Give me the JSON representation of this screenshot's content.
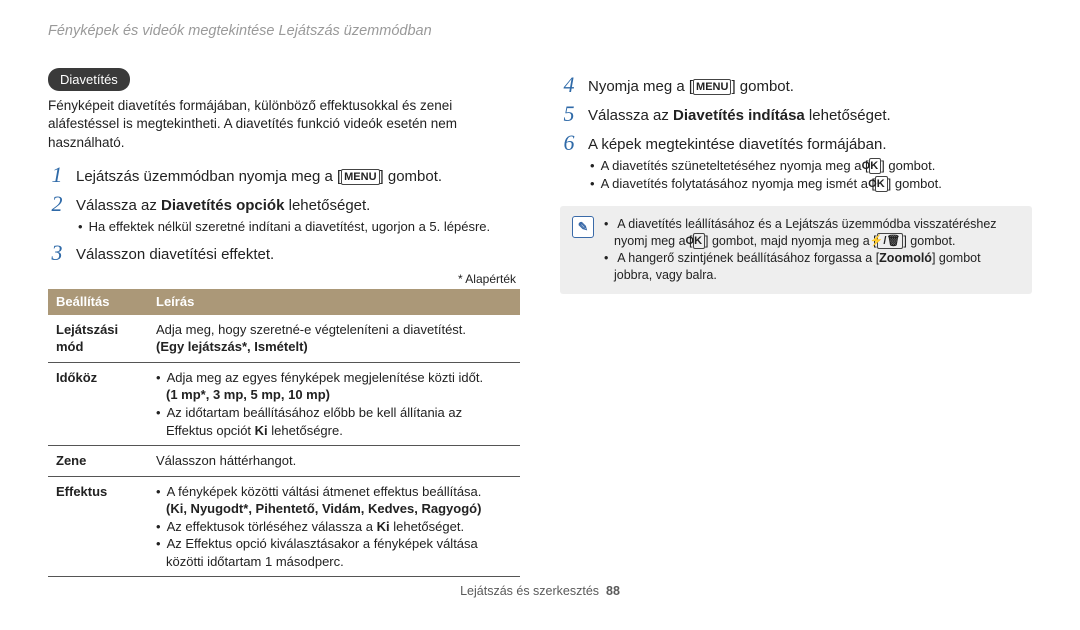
{
  "header": "Fényképek és videók megtekintése Lejátszás üzemmódban",
  "left": {
    "chip": "Diavetítés",
    "intro": "Fényképeit diavetítés formájában, különböző effektusokkal és zenei aláfestéssel is megtekintheti. A diavetítés funkció videók esetén nem használható.",
    "steps": {
      "s1_a": "Lejátszás üzemmódban nyomja meg a [",
      "s1_btn": "MENU",
      "s1_b": "] gombot.",
      "s2_a": "Válassza az ",
      "s2_bold": "Diavetítés opciók",
      "s2_b": " lehetőséget.",
      "s2_sub": "Ha effektek nélkül szeretné indítani a diavetítést, ugorjon a 5. lépésre.",
      "s3": "Válasszon diavetítési effektet."
    },
    "default_note": "* Alapérték",
    "table": {
      "h1": "Beállítás",
      "h2": "Leírás",
      "rows": [
        {
          "k": "Lejátszási mód",
          "lines": [
            "Adja meg, hogy szeretné-e végteleníteni a diavetítést."
          ],
          "opts": "(Egy lejátszás*, Ismételt)"
        },
        {
          "k": "Időköz",
          "bullets": [
            "Adja meg az egyes fényképek megjelenítése közti időt."
          ],
          "opts": "(1 mp*, 3 mp, 5 mp, 10 mp)",
          "bullets2": [
            "Az időtartam beállításához előbb be kell állítania az Effektus opciót Ki lehetőségre."
          ],
          "ki_bold": "Ki"
        },
        {
          "k": "Zene",
          "lines": [
            "Válasszon háttérhangot."
          ]
        },
        {
          "k": "Effektus",
          "bullets": [
            "A fényképek közötti váltási átmenet effektus beállítása."
          ],
          "opts": "(Ki, Nyugodt*, Pihentető, Vidám, Kedves, Ragyogó)",
          "bullets2": [
            "Az effektusok törléséhez válassza a Ki lehetőséget.",
            "Az Effektus opció kiválasztásakor a fényképek váltása közötti időtartam 1 másodperc."
          ]
        }
      ]
    }
  },
  "right": {
    "s4_a": "Nyomja meg a [",
    "s4_btn": "MENU",
    "s4_b": "] gombot.",
    "s5_a": "Válassza az ",
    "s5_bold": "Diavetítés indítása",
    "s5_b": " lehetőséget.",
    "s6": "A képek megtekintése diavetítés formájában.",
    "s6_b1_a": "A diavetítés szüneteltetéséhez nyomja meg a [",
    "s6_b1_btn": "OK",
    "s6_b1_b": "] gombot.",
    "s6_b2_a": "A diavetítés folytatásához nyomja meg ismét a [",
    "s6_b2_btn": "OK",
    "s6_b2_b": "] gombot.",
    "note": {
      "l1_a": "A diavetítés leállításához és a Lejátszás üzemmódba visszatéréshez nyomj meg a [",
      "l1_btn": "OK",
      "l1_b": "] gombot, majd nyomja meg a [",
      "l1_btn2": "⚡/🗑",
      "l1_c": "] gombot.",
      "l2_a": "A hangerő szintjének beállításához forgassa a [",
      "l2_bold": "Zoomoló",
      "l2_b": "] gombot jobbra, vagy balra."
    }
  },
  "footer_a": "Lejátszás és szerkesztés",
  "footer_pg": "88"
}
